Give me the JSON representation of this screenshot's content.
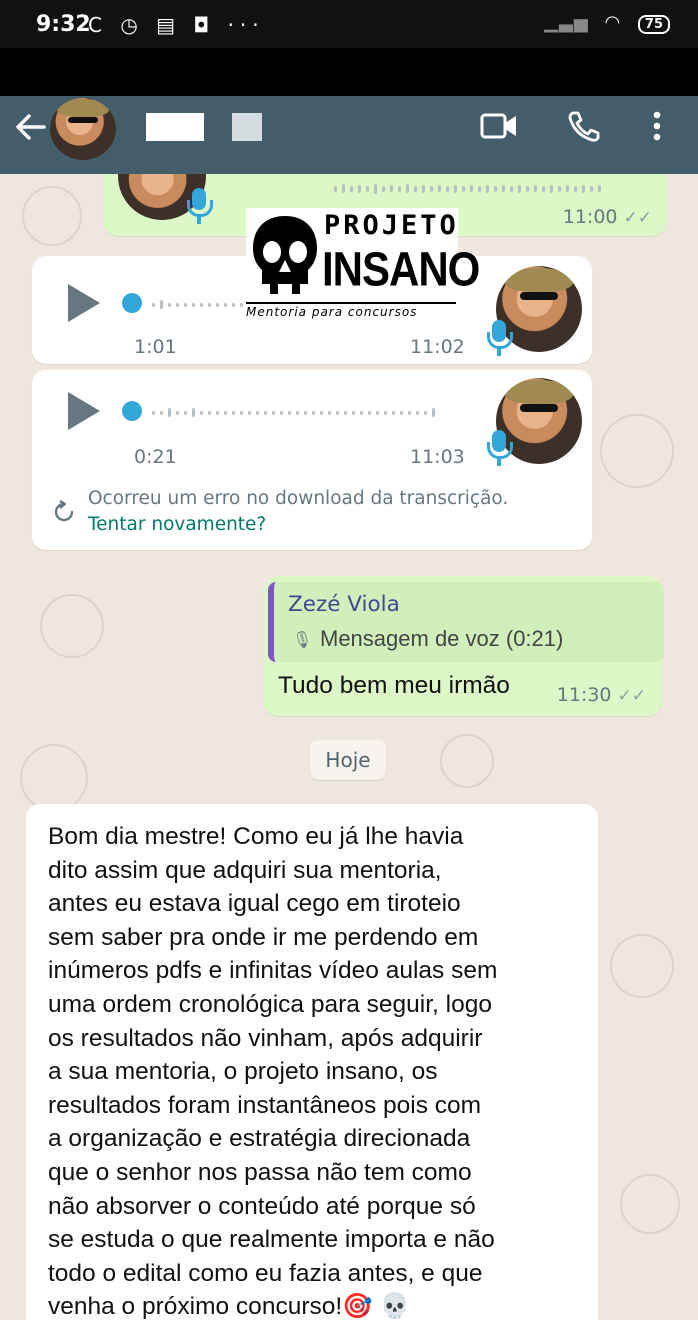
{
  "status_bar": {
    "time": "9:32",
    "icons": "C ◷ ▤ ◘ ···",
    "battery": "75"
  },
  "app_bar": {
    "back_icon": "arrow-left",
    "contact_name": "",
    "video_icon": "video-camera",
    "call_icon": "phone",
    "menu_icon": "more-vertical"
  },
  "logo": {
    "line1": "PROJETO",
    "line2": "INSANO",
    "tagline": "Mentoria para concursos"
  },
  "messages": {
    "top_partial": {
      "time": "11:00"
    },
    "voice1": {
      "duration": "1:01",
      "time": "11:02"
    },
    "voice2": {
      "duration": "0:21",
      "time": "11:03",
      "error_text": "Ocorreu um erro no download da transcrição.",
      "retry_label": "Tentar novamente?"
    },
    "reply": {
      "quoted_author": "Zezé Viola",
      "quoted_text": "Mensagem de voz (0:21)",
      "text": "Tudo bem meu irmão",
      "time": "11:30"
    },
    "date_chip": "Hoje",
    "long_message": {
      "text": "Bom dia mestre! Como eu já lhe havia\ndito assim que adquiri sua mentoria,\nantes eu estava igual cego em tiroteio\nsem saber pra onde ir me perdendo em\ninúmeros pdfs e infinitas vídeo aulas sem\numa ordem cronológica para seguir, logo\nos resultados não vinham, após adquirir\na sua mentoria, o projeto insano,  os\nresultados foram instantâneos pois com\na organização e estratégia direcionada\nque o senhor nos passa não tem como\nnão absorver o conteúdo até porque só\nse estuda o que realmente importa e não\ntodo o edital como eu fazia antes, e que\nvenha o próximo concurso!🎯 💀"
    }
  },
  "colors": {
    "app_bar": "#445d6a",
    "chat_bg": "#efe7de",
    "incoming": "#ffffff",
    "outgoing": "#dcf8c6",
    "accent_teal": "#00796b",
    "voice_blue": "#34a7d9"
  }
}
